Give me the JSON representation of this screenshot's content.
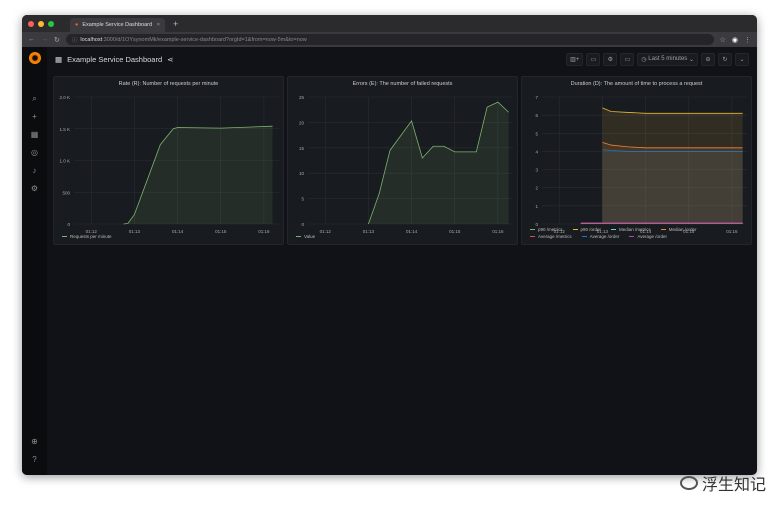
{
  "browser": {
    "tab_title": "Example Service Dashboard",
    "url_host": "localhost",
    "url_rest": ":3000/d/1OYsynomMk/example-service-dashboard?orgId=1&from=now-5m&to=now"
  },
  "dashboard": {
    "title": "Example Service Dashboard",
    "time_range": "Last 5 minutes"
  },
  "watermark": "浮生知记",
  "colors": {
    "accent": "#f46800",
    "series_green": "#7eb26d",
    "bg": "#111217"
  },
  "chart_data": [
    {
      "type": "area",
      "title": "Rate (R): Number of requests per minute",
      "xlim": [
        11.6,
        16.35
      ],
      "xticks": [
        "01:12",
        "01:13",
        "01:14",
        "01:15",
        "01:16"
      ],
      "xtick_values": [
        12,
        13,
        14,
        15,
        16
      ],
      "ylim": [
        0,
        2000
      ],
      "yticks": [
        "0",
        "500",
        "1.0 K",
        "1.5 K",
        "2.0 K"
      ],
      "ytick_values": [
        0,
        500,
        1000,
        1500,
        2000
      ],
      "series": [
        {
          "name": "Requests per minute",
          "color": "#7eb26d",
          "fill": true,
          "x": [
            12.75,
            12.85,
            13.0,
            13.3,
            13.6,
            13.9,
            14.0,
            15.0,
            16.2
          ],
          "y": [
            0,
            10,
            150,
            700,
            1250,
            1500,
            1520,
            1510,
            1540
          ]
        }
      ]
    },
    {
      "type": "area",
      "title": "Errors (E): The number of failed requests",
      "xlim": [
        11.6,
        16.35
      ],
      "xticks": [
        "01:12",
        "01:13",
        "01:14",
        "01:15",
        "01:16"
      ],
      "xtick_values": [
        12,
        13,
        14,
        15,
        16
      ],
      "ylim": [
        0,
        25
      ],
      "yticks": [
        "0",
        "5",
        "10",
        "15",
        "20",
        "25"
      ],
      "ytick_values": [
        0,
        5,
        10,
        15,
        20,
        25
      ],
      "series": [
        {
          "name": "Value",
          "color": "#7eb26d",
          "fill": true,
          "x": [
            13,
            13.25,
            13.5,
            14,
            14.25,
            14.5,
            14.75,
            15,
            15.5,
            15.75,
            16,
            16.25
          ],
          "y": [
            0,
            6,
            14.5,
            20.3,
            13,
            15.3,
            15.3,
            14.2,
            14.2,
            23,
            24,
            22
          ]
        }
      ]
    },
    {
      "type": "area",
      "title": "Duration (D): The amount of time to process a request",
      "xlim": [
        11.6,
        16.35
      ],
      "xticks": [
        "01:12",
        "01:13",
        "01:14",
        "01:15",
        "01:16"
      ],
      "xtick_values": [
        12,
        13,
        14,
        15,
        16
      ],
      "ylim": [
        0,
        7
      ],
      "yticks": [
        "0",
        "1",
        "2",
        "3",
        "4",
        "5",
        "6",
        "7"
      ],
      "ytick_values": [
        0,
        1,
        2,
        3,
        4,
        5,
        6,
        7
      ],
      "series": [
        {
          "name": "p90 /metrics",
          "color": "#7eb26d",
          "fill": false,
          "x": [
            12.5,
            16.25
          ],
          "y": [
            0.05,
            0.05
          ]
        },
        {
          "name": "p90 /order",
          "color": "#eab839",
          "fill": true,
          "x": [
            13,
            13.2,
            13.6,
            14,
            14.5,
            16.25
          ],
          "y": [
            6.4,
            6.2,
            6.15,
            6.1,
            6.1,
            6.1
          ]
        },
        {
          "name": "Median /metrics",
          "color": "#6ed0e0",
          "fill": false,
          "x": [
            12.5,
            16.25
          ],
          "y": [
            0.03,
            0.03
          ]
        },
        {
          "name": "Median /order",
          "color": "#ef843c",
          "fill": true,
          "x": [
            13,
            13.2,
            13.6,
            14,
            14.5,
            16.25
          ],
          "y": [
            4.5,
            4.35,
            4.25,
            4.2,
            4.2,
            4.2
          ]
        },
        {
          "name": "Average /metrics",
          "color": "#e24d42",
          "fill": false,
          "x": [
            12.5,
            16.25
          ],
          "y": [
            0.04,
            0.04
          ]
        },
        {
          "name": "Average /order",
          "color": "#1f78c1",
          "fill": true,
          "x": [
            13,
            13.2,
            13.6,
            14,
            16.25
          ],
          "y": [
            4.1,
            4.05,
            4.0,
            4.0,
            4.0
          ]
        },
        {
          "name": "Average /order",
          "color": "#ba43a9",
          "fill": false,
          "x": [
            12.5,
            16.25
          ],
          "y": [
            0.06,
            0.06
          ]
        }
      ]
    }
  ]
}
